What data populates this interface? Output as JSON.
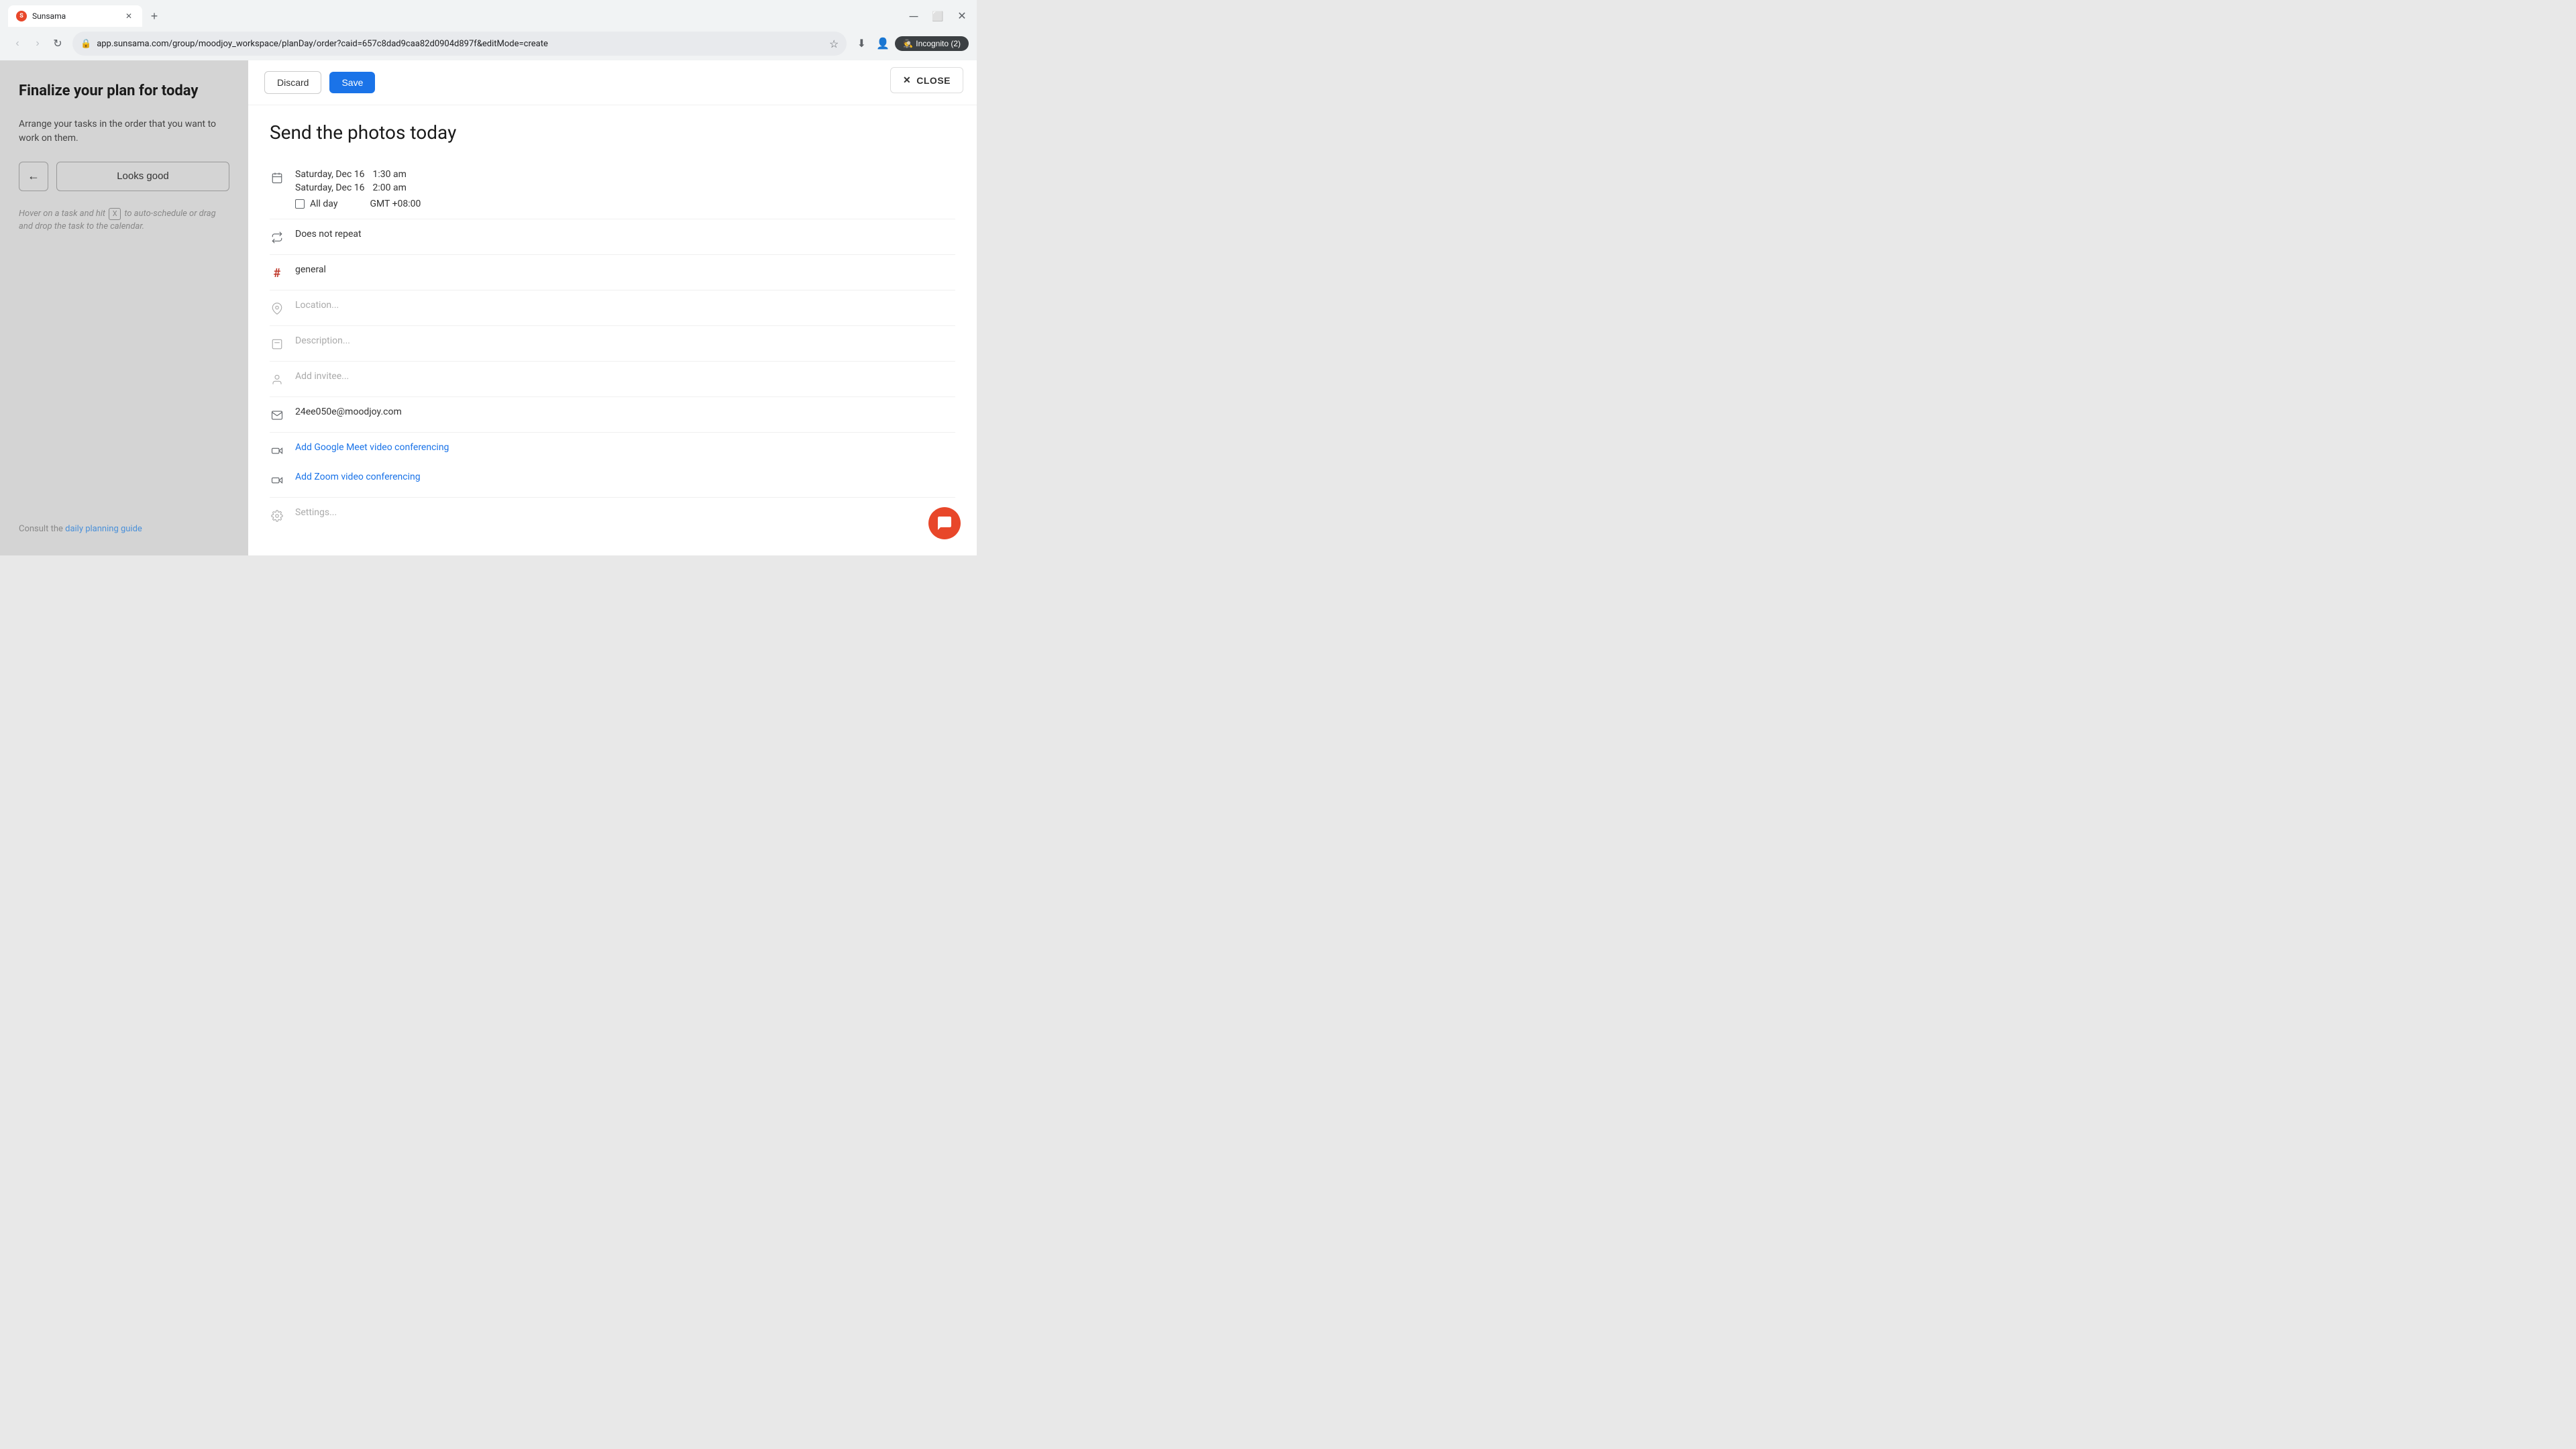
{
  "browser": {
    "tab_title": "Sunsama",
    "url": "app.sunsama.com/group/moodjoy_workspace/planDay/order?caid=657c8dad9caa82d0904d897f&editMode=create",
    "incognito_label": "Incognito (2)"
  },
  "sidebar": {
    "title": "Finalize your plan for today",
    "subtitle": "Arrange your tasks in the order that you want to work on them.",
    "back_button_label": "←",
    "looks_good_label": "Looks good",
    "hint": "Hover on a task and hit  X  to auto-schedule or drag and drop the task to the calendar.",
    "footer_text": "Consult the ",
    "footer_link": "daily planning guide"
  },
  "toolbar": {
    "discard_label": "Discard",
    "save_label": "Save"
  },
  "event": {
    "title": "Send the photos today",
    "date_start": "Saturday, Dec 16",
    "time_start": "1:30 am",
    "date_end": "Saturday, Dec 16",
    "time_end": "2:00 am",
    "allday_label": "All day",
    "timezone": "GMT +08:00",
    "repeat": "Does not repeat",
    "channel": "general",
    "location_placeholder": "Location...",
    "description_placeholder": "Description...",
    "invitee_placeholder": "Add invitee...",
    "organizer_email": "24ee050e@moodjoy.com",
    "google_meet_label": "Add Google Meet video conferencing",
    "zoom_label": "Add Zoom video conferencing",
    "settings_placeholder": "Settings..."
  },
  "close_button": {
    "label": "CLOSE"
  },
  "icons": {
    "calendar": "calendar-icon",
    "repeat": "repeat-icon",
    "hashtag": "hashtag-icon",
    "location": "location-icon",
    "description": "description-icon",
    "person": "person-icon",
    "email": "email-icon",
    "video": "video-icon",
    "gear": "gear-icon"
  }
}
